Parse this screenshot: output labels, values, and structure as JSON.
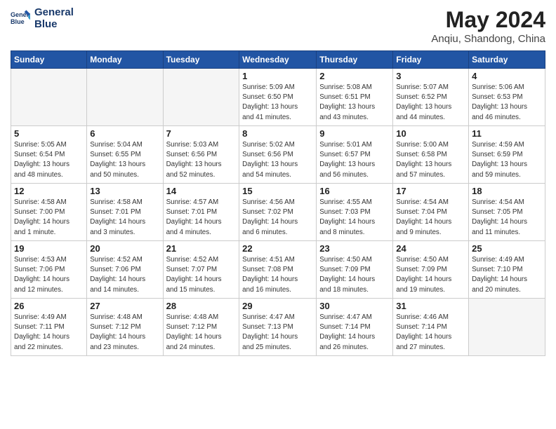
{
  "header": {
    "logo_line1": "General",
    "logo_line2": "Blue",
    "month": "May 2024",
    "location": "Anqiu, Shandong, China"
  },
  "weekdays": [
    "Sunday",
    "Monday",
    "Tuesday",
    "Wednesday",
    "Thursday",
    "Friday",
    "Saturday"
  ],
  "weeks": [
    [
      {
        "day": "",
        "info": ""
      },
      {
        "day": "",
        "info": ""
      },
      {
        "day": "",
        "info": ""
      },
      {
        "day": "1",
        "info": "Sunrise: 5:09 AM\nSunset: 6:50 PM\nDaylight: 13 hours\nand 41 minutes."
      },
      {
        "day": "2",
        "info": "Sunrise: 5:08 AM\nSunset: 6:51 PM\nDaylight: 13 hours\nand 43 minutes."
      },
      {
        "day": "3",
        "info": "Sunrise: 5:07 AM\nSunset: 6:52 PM\nDaylight: 13 hours\nand 44 minutes."
      },
      {
        "day": "4",
        "info": "Sunrise: 5:06 AM\nSunset: 6:53 PM\nDaylight: 13 hours\nand 46 minutes."
      }
    ],
    [
      {
        "day": "5",
        "info": "Sunrise: 5:05 AM\nSunset: 6:54 PM\nDaylight: 13 hours\nand 48 minutes."
      },
      {
        "day": "6",
        "info": "Sunrise: 5:04 AM\nSunset: 6:55 PM\nDaylight: 13 hours\nand 50 minutes."
      },
      {
        "day": "7",
        "info": "Sunrise: 5:03 AM\nSunset: 6:56 PM\nDaylight: 13 hours\nand 52 minutes."
      },
      {
        "day": "8",
        "info": "Sunrise: 5:02 AM\nSunset: 6:56 PM\nDaylight: 13 hours\nand 54 minutes."
      },
      {
        "day": "9",
        "info": "Sunrise: 5:01 AM\nSunset: 6:57 PM\nDaylight: 13 hours\nand 56 minutes."
      },
      {
        "day": "10",
        "info": "Sunrise: 5:00 AM\nSunset: 6:58 PM\nDaylight: 13 hours\nand 57 minutes."
      },
      {
        "day": "11",
        "info": "Sunrise: 4:59 AM\nSunset: 6:59 PM\nDaylight: 13 hours\nand 59 minutes."
      }
    ],
    [
      {
        "day": "12",
        "info": "Sunrise: 4:58 AM\nSunset: 7:00 PM\nDaylight: 14 hours\nand 1 minute."
      },
      {
        "day": "13",
        "info": "Sunrise: 4:58 AM\nSunset: 7:01 PM\nDaylight: 14 hours\nand 3 minutes."
      },
      {
        "day": "14",
        "info": "Sunrise: 4:57 AM\nSunset: 7:01 PM\nDaylight: 14 hours\nand 4 minutes."
      },
      {
        "day": "15",
        "info": "Sunrise: 4:56 AM\nSunset: 7:02 PM\nDaylight: 14 hours\nand 6 minutes."
      },
      {
        "day": "16",
        "info": "Sunrise: 4:55 AM\nSunset: 7:03 PM\nDaylight: 14 hours\nand 8 minutes."
      },
      {
        "day": "17",
        "info": "Sunrise: 4:54 AM\nSunset: 7:04 PM\nDaylight: 14 hours\nand 9 minutes."
      },
      {
        "day": "18",
        "info": "Sunrise: 4:54 AM\nSunset: 7:05 PM\nDaylight: 14 hours\nand 11 minutes."
      }
    ],
    [
      {
        "day": "19",
        "info": "Sunrise: 4:53 AM\nSunset: 7:06 PM\nDaylight: 14 hours\nand 12 minutes."
      },
      {
        "day": "20",
        "info": "Sunrise: 4:52 AM\nSunset: 7:06 PM\nDaylight: 14 hours\nand 14 minutes."
      },
      {
        "day": "21",
        "info": "Sunrise: 4:52 AM\nSunset: 7:07 PM\nDaylight: 14 hours\nand 15 minutes."
      },
      {
        "day": "22",
        "info": "Sunrise: 4:51 AM\nSunset: 7:08 PM\nDaylight: 14 hours\nand 16 minutes."
      },
      {
        "day": "23",
        "info": "Sunrise: 4:50 AM\nSunset: 7:09 PM\nDaylight: 14 hours\nand 18 minutes."
      },
      {
        "day": "24",
        "info": "Sunrise: 4:50 AM\nSunset: 7:09 PM\nDaylight: 14 hours\nand 19 minutes."
      },
      {
        "day": "25",
        "info": "Sunrise: 4:49 AM\nSunset: 7:10 PM\nDaylight: 14 hours\nand 20 minutes."
      }
    ],
    [
      {
        "day": "26",
        "info": "Sunrise: 4:49 AM\nSunset: 7:11 PM\nDaylight: 14 hours\nand 22 minutes."
      },
      {
        "day": "27",
        "info": "Sunrise: 4:48 AM\nSunset: 7:12 PM\nDaylight: 14 hours\nand 23 minutes."
      },
      {
        "day": "28",
        "info": "Sunrise: 4:48 AM\nSunset: 7:12 PM\nDaylight: 14 hours\nand 24 minutes."
      },
      {
        "day": "29",
        "info": "Sunrise: 4:47 AM\nSunset: 7:13 PM\nDaylight: 14 hours\nand 25 minutes."
      },
      {
        "day": "30",
        "info": "Sunrise: 4:47 AM\nSunset: 7:14 PM\nDaylight: 14 hours\nand 26 minutes."
      },
      {
        "day": "31",
        "info": "Sunrise: 4:46 AM\nSunset: 7:14 PM\nDaylight: 14 hours\nand 27 minutes."
      },
      {
        "day": "",
        "info": ""
      }
    ]
  ]
}
